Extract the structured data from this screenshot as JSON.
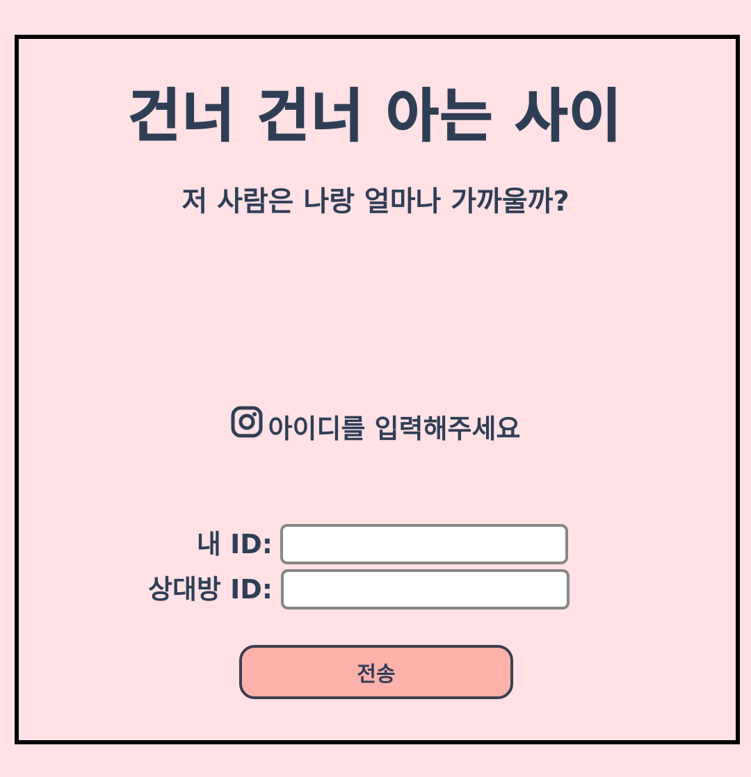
{
  "header": {
    "title": "건너 건너 아는 사이",
    "subtitle": "저 사람은 나랑 얼마나 가까울까?"
  },
  "form": {
    "prompt_icon": "instagram-icon",
    "prompt": "아이디를 입력해주세요",
    "my_id_label": "내 ID:",
    "my_id_value": "",
    "other_id_label": "상대방 ID:",
    "other_id_value": "",
    "submit_label": "전송"
  },
  "colors": {
    "background": "#ffe1e6",
    "text": "#2f3e55",
    "frame": "#000000",
    "input_border": "#858585",
    "button_fill": "#ffb1ac",
    "button_border": "#3a3f4e"
  }
}
